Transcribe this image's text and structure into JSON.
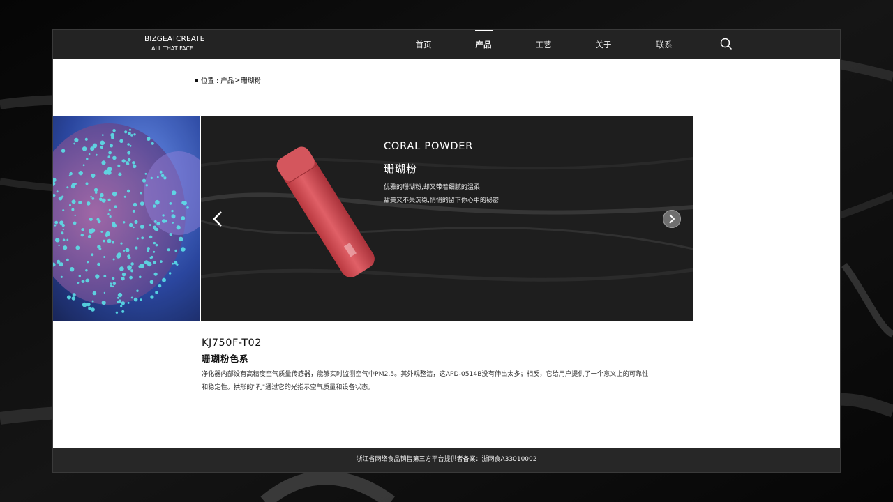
{
  "header": {
    "logo_main": "BIZGEATCREATE",
    "logo_sub": "ALL THAT FACE",
    "nav": [
      {
        "label": "首页"
      },
      {
        "label": "产品"
      },
      {
        "label": "工艺"
      },
      {
        "label": "关于"
      },
      {
        "label": "联系"
      }
    ],
    "active_nav": "产品"
  },
  "breadcrumb": {
    "prefix": "位置 :",
    "items": [
      "产品",
      "珊瑚粉"
    ],
    "separator": ">"
  },
  "banner": {
    "title_en": "CORAL POWDER",
    "title_cn": "珊瑚粉",
    "desc_lines": [
      "优雅的珊瑚粉,却又带着细腻的温柔",
      "甜美又不失沉稳,悄悄的留下你心中的秘密"
    ],
    "prev_icon": "chevron-left-icon",
    "next_icon": "chevron-right-circle-icon"
  },
  "product": {
    "model": "KJ750F-T02",
    "series": "珊瑚粉色系",
    "description_lines": [
      "净化器内部设有高精度空气质量传感器，能够实时监测空气中PM2.5。其外观整洁，这APD-0514B没有伸出太多；相反，它给用户提供了一个意义上的可靠性",
      "和稳定性。拱形的\"孔\"通过它的光指示空气质量和设备状态。"
    ]
  },
  "footer": {
    "text": "浙江省网络食品销售第三方平台提供者备案：浙网食A33010002"
  },
  "colors": {
    "topbar": "#232323",
    "bottle": "#d9545a",
    "coral_blue": "#2a6fd8",
    "coral_cyan": "#4fe3e8",
    "coral_pink": "#c77ab8"
  }
}
